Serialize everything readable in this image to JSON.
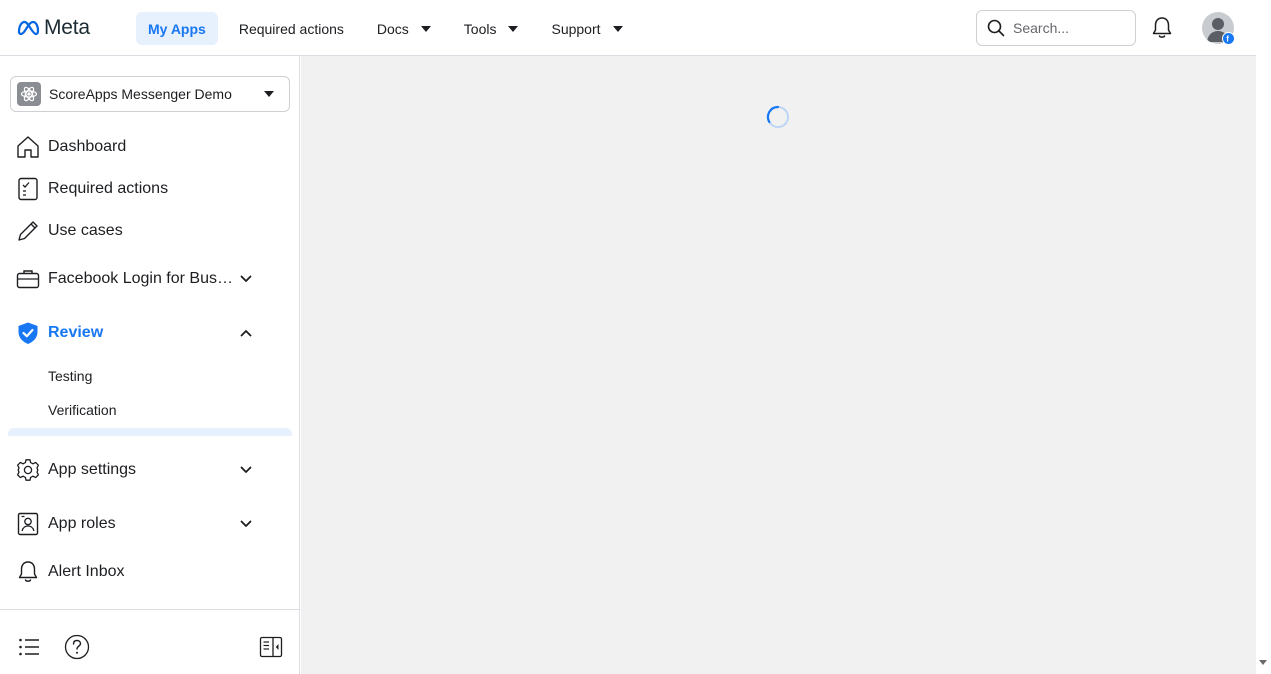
{
  "brand": {
    "name": "Meta"
  },
  "nav": {
    "items": [
      {
        "label": "My Apps",
        "active": true,
        "dropdown": false
      },
      {
        "label": "Required actions",
        "active": false,
        "dropdown": false
      },
      {
        "label": "Docs",
        "active": false,
        "dropdown": true
      },
      {
        "label": "Tools",
        "active": false,
        "dropdown": true
      },
      {
        "label": "Support",
        "active": false,
        "dropdown": true
      }
    ]
  },
  "search": {
    "placeholder": "Search..."
  },
  "app_selector": {
    "name": "ScoreApps Messenger Demo"
  },
  "sidebar": {
    "items": [
      {
        "label": "Dashboard",
        "icon": "home-icon"
      },
      {
        "label": "Required actions",
        "icon": "checklist-icon"
      },
      {
        "label": "Use cases",
        "icon": "pencil-icon"
      },
      {
        "label": "Facebook Login for Business",
        "icon": "briefcase-icon",
        "expandable": true
      },
      {
        "label": "Review",
        "icon": "shield-check-icon",
        "expandable": true,
        "expanded": true,
        "active": true
      },
      {
        "label": "App settings",
        "icon": "gear-icon",
        "expandable": true
      },
      {
        "label": "App roles",
        "icon": "person-badge-icon",
        "expandable": true
      },
      {
        "label": "Alert Inbox",
        "icon": "bell-icon"
      }
    ],
    "review_sub": [
      "Testing",
      "Verification"
    ]
  },
  "colors": {
    "accent": "#1877f2",
    "main_bg": "#f1f1f1"
  }
}
